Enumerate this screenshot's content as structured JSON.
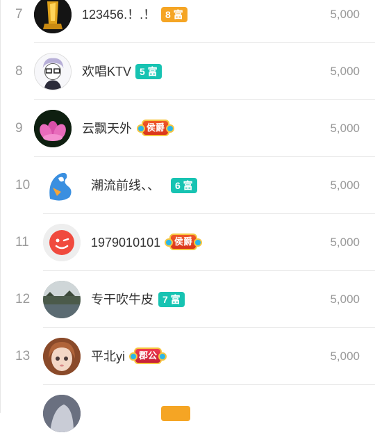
{
  "ranking": {
    "rows": [
      {
        "rank": "7",
        "name": "123456.！.！",
        "badge": "8 富",
        "value": "5,000",
        "avatar": "gold-trophy-avatar"
      },
      {
        "rank": "8",
        "name": "欢唱KTV",
        "badge": "5 富",
        "value": "5,000",
        "avatar": "cartoon-glasses-avatar"
      },
      {
        "rank": "9",
        "name": "云飘天外",
        "badge": "侯爵",
        "value": "5,000",
        "avatar": "lotus-flower-avatar"
      },
      {
        "rank": "10",
        "name": "潮流前线、、",
        "badge": "6 富",
        "value": "5,000",
        "avatar": "blue-mascot-avatar"
      },
      {
        "rank": "11",
        "name": "1979010101",
        "badge": "侯爵",
        "value": "5,000",
        "avatar": "red-wink-face-avatar"
      },
      {
        "rank": "12",
        "name": "专干吹牛皮",
        "badge": "7 富",
        "value": "5,000",
        "avatar": "landscape-photo-avatar"
      },
      {
        "rank": "13",
        "name": "平北yi",
        "badge": "郡公",
        "value": "5,000",
        "avatar": "doll-face-avatar"
      },
      {
        "rank": "",
        "name": "",
        "badge": "",
        "value": "",
        "avatar": "partial-avatar"
      }
    ]
  },
  "colors": {
    "rank_text": "#9a9a9a",
    "name_text": "#333333",
    "badge_orange": "#f5a524",
    "badge_teal": "#17c3b2",
    "badge_noble_orange": "#e8461f",
    "badge_noble_red": "#d62a40"
  }
}
